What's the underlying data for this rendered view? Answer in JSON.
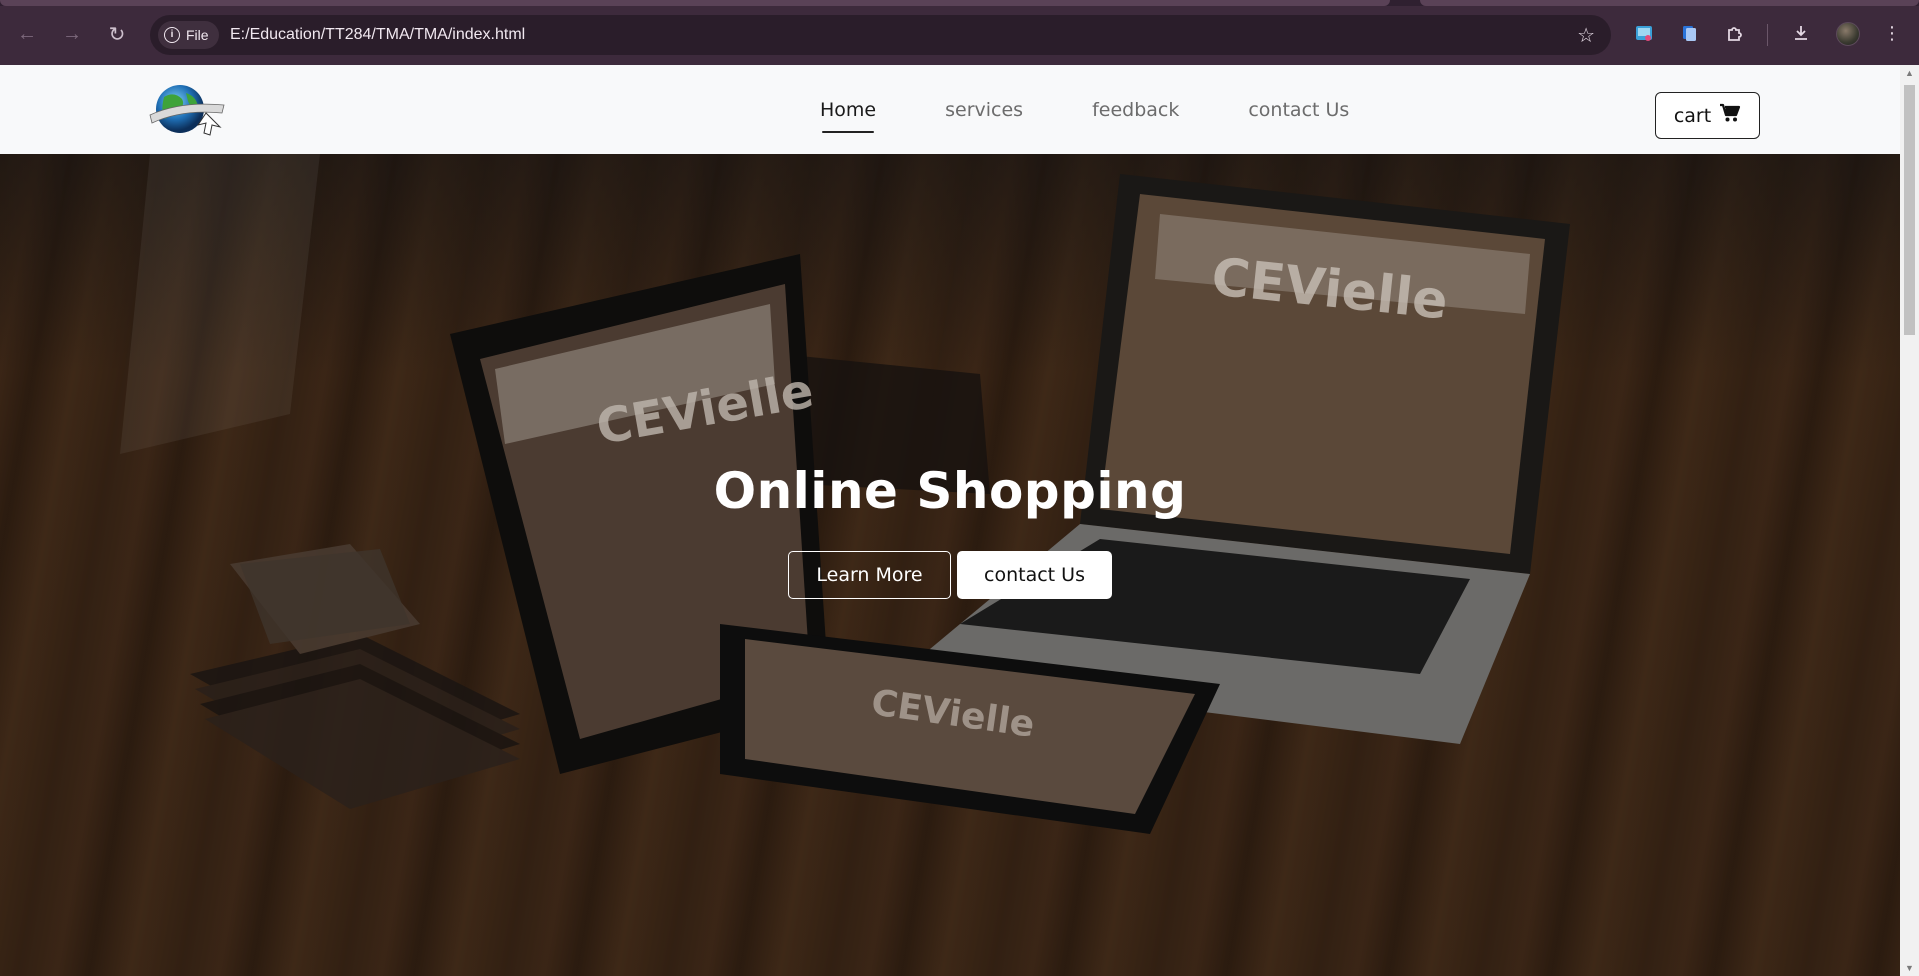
{
  "browser": {
    "file_chip": "File",
    "url": "E:/Education/TT284/TMA/TMA/index.html",
    "icons": [
      "back-icon",
      "forward-icon",
      "reload-icon",
      "info-icon",
      "star-icon",
      "extension-icon",
      "download-icon",
      "menu-icon"
    ]
  },
  "navbar": {
    "links": [
      {
        "label": "Home",
        "active": true
      },
      {
        "label": "services",
        "active": false
      },
      {
        "label": "feedback",
        "active": false
      },
      {
        "label": "contact Us",
        "active": false
      }
    ],
    "cart_label": "cart"
  },
  "hero": {
    "title": "Online Shopping",
    "learn_more": "Learn More",
    "contact": "contact Us"
  },
  "colors": {
    "chrome_bg": "#3d2a3c",
    "omnibox_bg": "#2a1d2a",
    "navbar_bg": "#f8f9fa",
    "hero_text": "#ffffff"
  }
}
